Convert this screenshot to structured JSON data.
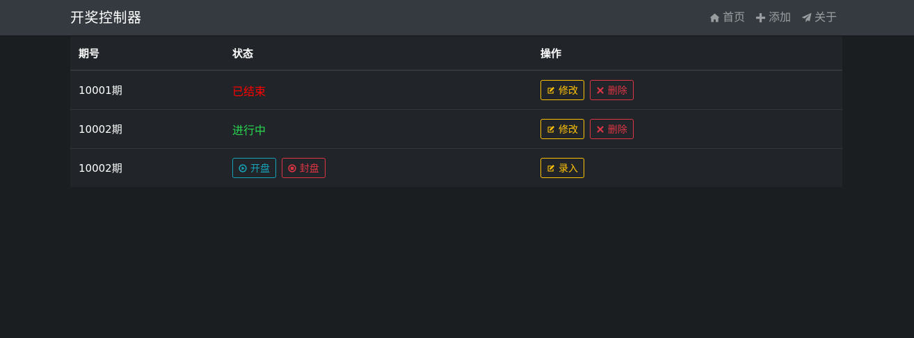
{
  "navbar": {
    "brand": "开奖控制器",
    "items": [
      {
        "label": "首页",
        "icon": "home-icon"
      },
      {
        "label": "添加",
        "icon": "plus-icon"
      },
      {
        "label": "关于",
        "icon": "paper-plane-icon"
      }
    ]
  },
  "table": {
    "headers": [
      "期号",
      "状态",
      "操作"
    ],
    "rows": [
      {
        "period": "10001期",
        "status": "已结束",
        "status_color": "#ff0000",
        "actions": [
          "修改",
          "删除"
        ]
      },
      {
        "period": "10002期",
        "status": "进行中",
        "status_color": "#28d850",
        "actions": [
          "修改",
          "删除"
        ]
      },
      {
        "period": "10002期",
        "status_buttons": [
          "开盘",
          "封盘"
        ],
        "actions": [
          "录入"
        ]
      }
    ]
  },
  "colors": {
    "warning": "#ffc107",
    "danger": "#dc3545",
    "info": "#17a2b8",
    "navbar_bg": "#343a40",
    "table_bg": "#212529",
    "page_bg": "#1b1e21"
  }
}
